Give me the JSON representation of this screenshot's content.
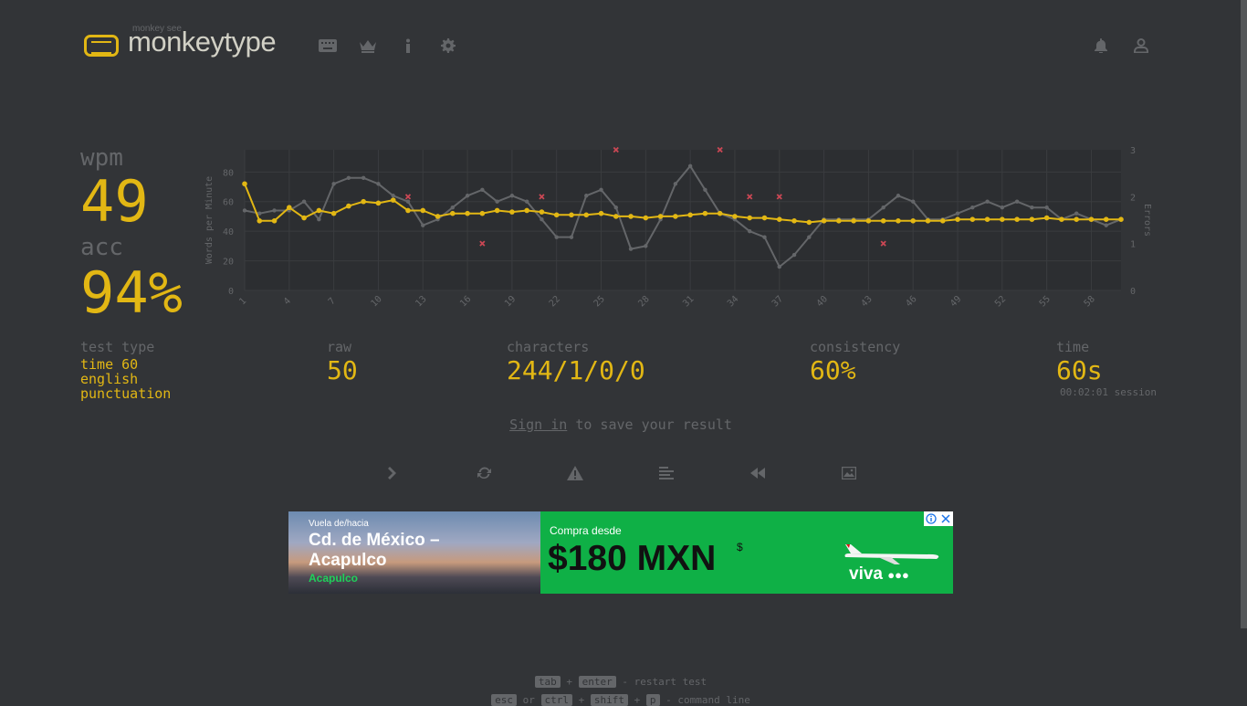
{
  "header": {
    "logo_sub": "monkey see",
    "logo_text": "monkeytype",
    "nav_icons": [
      "keyboard-icon",
      "crown-icon",
      "info-icon",
      "gear-icon"
    ],
    "right_icons": [
      "bell-icon",
      "user-icon"
    ]
  },
  "stats": {
    "wpm_label": "wpm",
    "wpm_value": "49",
    "acc_label": "acc",
    "acc_value": "94%",
    "test_type_label": "test type",
    "test_type_lines": [
      "time 60",
      "english",
      "punctuation"
    ],
    "raw_label": "raw",
    "raw_value": "50",
    "characters_label": "characters",
    "characters_value": "244/1/0/0",
    "consistency_label": "consistency",
    "consistency_value": "60%",
    "time_label": "time",
    "time_value": "60s",
    "session_text": "00:02:01 session"
  },
  "chart_data": {
    "type": "line",
    "ylabel": "Words per Minute",
    "y2label": "Errors",
    "ylim": [
      0,
      95
    ],
    "y2lim": [
      0,
      3
    ],
    "yticks": [
      0,
      20,
      40,
      60,
      80
    ],
    "y2ticks": [
      0,
      1,
      2,
      3
    ],
    "xticks": [
      1,
      4,
      7,
      10,
      13,
      16,
      19,
      22,
      25,
      28,
      31,
      34,
      37,
      40,
      43,
      46,
      49,
      52,
      55,
      58
    ],
    "x": [
      1,
      2,
      3,
      4,
      5,
      6,
      7,
      8,
      9,
      10,
      11,
      12,
      13,
      14,
      15,
      16,
      17,
      18,
      19,
      20,
      21,
      22,
      23,
      24,
      25,
      26,
      27,
      28,
      29,
      30,
      31,
      32,
      33,
      34,
      35,
      36,
      37,
      38,
      39,
      40,
      41,
      42,
      43,
      44,
      45,
      46,
      47,
      48,
      49,
      50,
      51,
      52,
      53,
      54,
      55,
      56,
      57,
      58,
      59,
      60
    ],
    "grid": true,
    "colors": {
      "wpm": "#e2b714",
      "raw": "#646669",
      "errors": "#ca4754"
    },
    "series": [
      {
        "name": "wpm",
        "values": [
          72,
          47,
          47,
          56,
          49,
          54,
          52,
          57,
          60,
          59,
          61,
          54,
          54,
          50,
          52,
          52,
          52,
          54,
          53,
          54,
          53,
          51,
          51,
          51,
          52,
          50,
          50,
          49,
          50,
          50,
          51,
          52,
          52,
          50,
          49,
          49,
          48,
          47,
          46,
          47,
          47,
          47,
          47,
          47,
          47,
          47,
          47,
          47,
          48,
          48,
          48,
          48,
          48,
          48,
          49,
          48,
          48,
          48,
          48,
          48
        ]
      },
      {
        "name": "raw",
        "values": [
          54,
          52,
          54,
          54,
          60,
          48,
          72,
          76,
          76,
          72,
          64,
          60,
          44,
          48,
          56,
          64,
          68,
          60,
          64,
          60,
          48,
          36,
          36,
          64,
          68,
          56,
          28,
          30,
          48,
          72,
          84,
          68,
          52,
          48,
          40,
          36,
          16,
          24,
          36,
          48,
          48,
          48,
          48,
          56,
          64,
          60,
          48,
          48,
          52,
          56,
          60,
          56,
          60,
          56,
          56,
          48,
          52,
          48,
          44,
          48
        ]
      },
      {
        "name": "errors",
        "points": [
          [
            12,
            2
          ],
          [
            17,
            1
          ],
          [
            21,
            2
          ],
          [
            26,
            3
          ],
          [
            33,
            3
          ],
          [
            35,
            2
          ],
          [
            37,
            2
          ],
          [
            44,
            1
          ]
        ]
      }
    ]
  },
  "signin": {
    "link": "Sign in",
    "rest": " to save your result"
  },
  "buttons": [
    "next-test",
    "restart-test",
    "report-words",
    "word-history",
    "replay",
    "save-screenshot"
  ],
  "ad": {
    "left_small": "Vuela de/hacia",
    "left_title1": "Cd. de México –",
    "left_title2": "Acapulco",
    "left_green": "Acapulco",
    "right_small": "Compra desde",
    "right_price": "$180 MXN",
    "right_dollar": "$",
    "brand": "viva",
    "brand_dots": "●●●",
    "color_green": "#0fb046"
  },
  "footer": {
    "line1": {
      "key1": "tab",
      "plus": "+",
      "key2": "enter",
      "text": "- restart test"
    },
    "line2": {
      "key1": "esc",
      "or": "or",
      "key2": "ctrl",
      "plus1": "+",
      "key3": "shift",
      "plus2": "+",
      "key4": "p",
      "text": "- command line"
    }
  }
}
